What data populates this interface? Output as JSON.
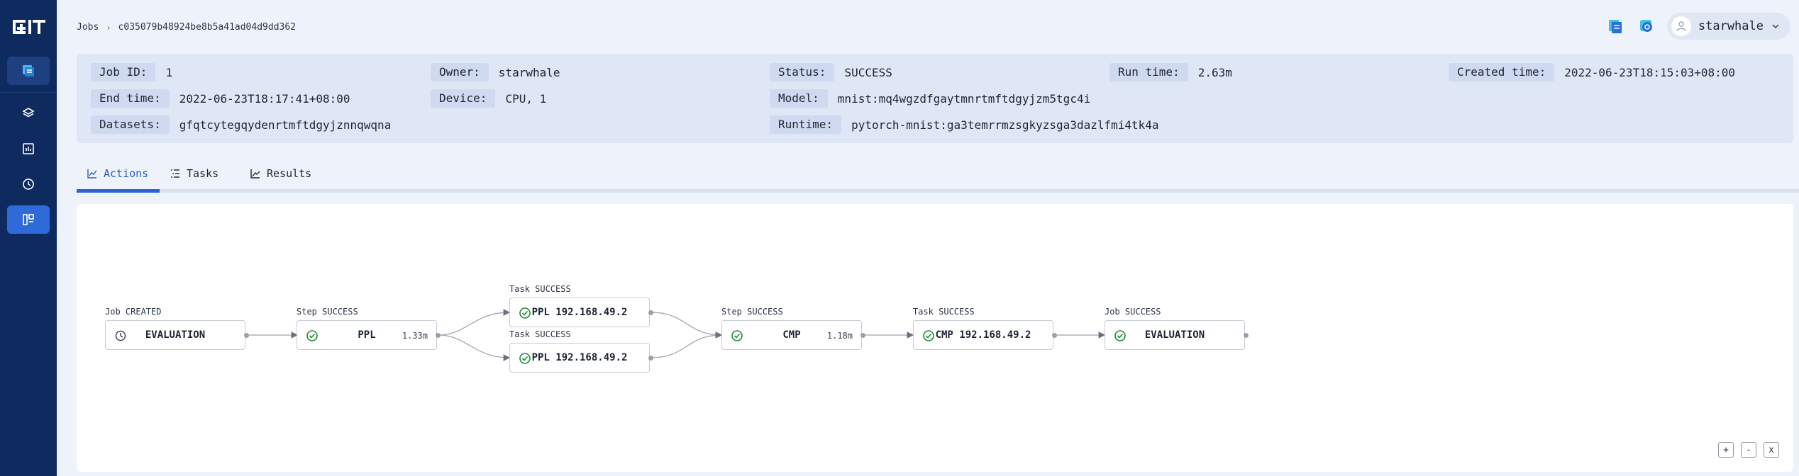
{
  "sidebar": {
    "logo_icon": "starwhale-logo",
    "items": [
      {
        "icon": "projects-icon"
      },
      {
        "icon": "layers-icon"
      },
      {
        "icon": "chart-icon"
      },
      {
        "icon": "history-icon"
      },
      {
        "icon": "jobs-icon"
      }
    ]
  },
  "header": {
    "breadcrumb": {
      "root": "Jobs",
      "separator": "›",
      "current": "c035079b48924be8b5a41ad04d9dd362"
    },
    "user": {
      "name": "starwhale"
    }
  },
  "info": {
    "job_id": {
      "label": "Job ID:",
      "value": "1"
    },
    "owner": {
      "label": "Owner:",
      "value": "starwhale"
    },
    "status": {
      "label": "Status:",
      "value": "SUCCESS"
    },
    "run_time": {
      "label": "Run time:",
      "value": "2.63m"
    },
    "created_time": {
      "label": "Created time:",
      "value": "2022-06-23T18:15:03+08:00"
    },
    "end_time": {
      "label": "End time:",
      "value": "2022-06-23T18:17:41+08:00"
    },
    "device": {
      "label": "Device:",
      "value": "CPU, 1"
    },
    "model": {
      "label": "Model:",
      "value": "mnist:mq4wgzdfgaytmnrtmftdgyjzm5tgc4i"
    },
    "datasets": {
      "label": "Datasets:",
      "value": "gfqtcytegqydenrtmftdgyjznnqwqna"
    },
    "runtime": {
      "label": "Runtime:",
      "value": "pytorch-mnist:ga3temrrmzsgkyzsga3dazlfmi4tk4a"
    }
  },
  "tabs": [
    {
      "label": "Actions",
      "icon": "line-chart-icon",
      "active": true
    },
    {
      "label": "Tasks",
      "icon": "list-icon",
      "active": false
    },
    {
      "label": "Results",
      "icon": "trend-icon",
      "active": false
    }
  ],
  "flow": {
    "nodes": [
      {
        "caption": "Job CREATED",
        "title": "EVALUATION",
        "duration": "",
        "icon": "clock-icon"
      },
      {
        "caption": "Step SUCCESS",
        "title": "PPL",
        "duration": "1.33m",
        "icon": "check-circle-icon"
      },
      {
        "caption": "Task SUCCESS",
        "title": "PPL 192.168.49.2",
        "duration": "",
        "icon": "check-circle-icon"
      },
      {
        "caption": "Task SUCCESS",
        "title": "PPL 192.168.49.2",
        "duration": "",
        "icon": "check-circle-icon"
      },
      {
        "caption": "Step SUCCESS",
        "title": "CMP",
        "duration": "1.18m",
        "icon": "check-circle-icon"
      },
      {
        "caption": "Task SUCCESS",
        "title": "CMP 192.168.49.2",
        "duration": "",
        "icon": "check-circle-icon"
      },
      {
        "caption": "Job SUCCESS",
        "title": "EVALUATION",
        "duration": "",
        "icon": "check-circle-icon"
      }
    ],
    "zoom": {
      "in": "+",
      "out": "-",
      "reset": "x"
    }
  },
  "colors": {
    "sidebar": "#0f2a5e",
    "accent": "#2b63d1",
    "success": "#1f8a3a"
  }
}
